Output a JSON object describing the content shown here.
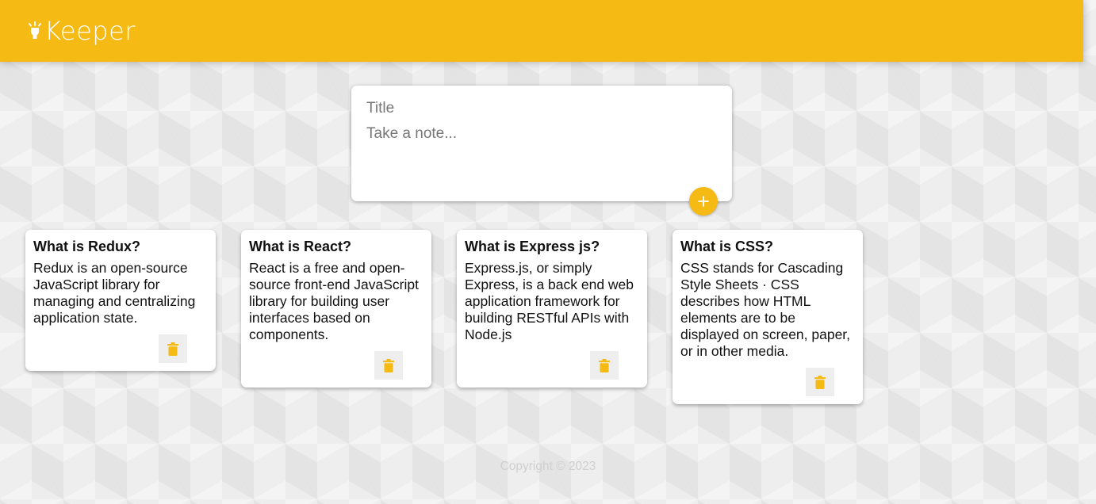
{
  "header": {
    "logo_text": "Keeper",
    "logo_icon": "lightbulb-icon"
  },
  "create_note": {
    "title_placeholder": "Title",
    "content_placeholder": "Take a note...",
    "title_value": "",
    "content_value": "",
    "add_icon": "plus-icon"
  },
  "notes": [
    {
      "title": "What is Redux?",
      "content": "Redux is an open-source JavaScript library for managing and centralizing application state.",
      "delete_icon": "trash-icon"
    },
    {
      "title": "What is React?",
      "content": "React is a free and open-source front-end JavaScript library for building user interfaces based on components.",
      "delete_icon": "trash-icon"
    },
    {
      "title": "What is Express js?",
      "content": "Express.js, or simply Express, is a back end web application framework for building RESTful APIs with Node.js",
      "delete_icon": "trash-icon"
    },
    {
      "title": "What is CSS?",
      "content": "CSS stands for Cascading Style Sheets · CSS describes how HTML elements are to be displayed on screen, paper, or in other media.",
      "delete_icon": "trash-icon"
    }
  ],
  "footer": {
    "copyright": "Copyright © 2023"
  },
  "colors": {
    "accent": "#f5ba13",
    "background": "#eeeeee",
    "card": "#ffffff",
    "footer_text": "#cfcfcf"
  }
}
